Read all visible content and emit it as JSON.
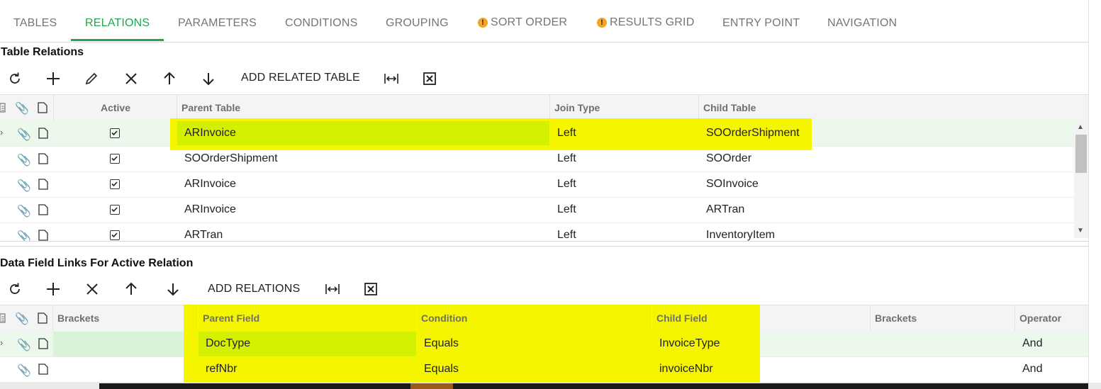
{
  "tabs": [
    {
      "label": "TABLES",
      "warning": false
    },
    {
      "label": "RELATIONS",
      "warning": false,
      "active": true
    },
    {
      "label": "PARAMETERS",
      "warning": false
    },
    {
      "label": "CONDITIONS",
      "warning": false
    },
    {
      "label": "GROUPING",
      "warning": false
    },
    {
      "label": "SORT ORDER",
      "warning": true
    },
    {
      "label": "RESULTS GRID",
      "warning": true
    },
    {
      "label": "ENTRY POINT",
      "warning": false
    },
    {
      "label": "NAVIGATION",
      "warning": false
    }
  ],
  "relations": {
    "title": "Table Relations",
    "toolbar": {
      "add_related_table": "ADD RELATED TABLE"
    },
    "columns": {
      "active": "Active",
      "parent_table": "Parent Table",
      "join_type": "Join Type",
      "child_table": "Child Table"
    },
    "rows": [
      {
        "active": true,
        "parent": "ARInvoice",
        "join": "Left",
        "child": "SOOrderShipment"
      },
      {
        "active": true,
        "parent": "SOOrderShipment",
        "join": "Left",
        "child": "SOOrder"
      },
      {
        "active": true,
        "parent": "ARInvoice",
        "join": "Left",
        "child": "SOInvoice"
      },
      {
        "active": true,
        "parent": "ARInvoice",
        "join": "Left",
        "child": "ARTran"
      },
      {
        "active": true,
        "parent": "ARTran",
        "join": "Left",
        "child": "InventoryItem"
      }
    ]
  },
  "links": {
    "title": "Data Field Links For Active Relation",
    "toolbar": {
      "add_relations": "ADD RELATIONS"
    },
    "columns": {
      "brackets_left": "Brackets",
      "parent_field": "Parent Field",
      "condition": "Condition",
      "child_field": "Child Field",
      "brackets_right": "Brackets",
      "operator": "Operator"
    },
    "rows": [
      {
        "parent": "DocType",
        "condition": "Equals",
        "child": "InvoiceType",
        "operator": "And"
      },
      {
        "parent": "refNbr",
        "condition": "Equals",
        "child": "invoiceNbr",
        "operator": "And"
      }
    ]
  },
  "colors": {
    "accent": "#21a64b",
    "highlight": "#f5f500",
    "selected_row": "#ecf8ec",
    "warning": "#f5a623"
  }
}
